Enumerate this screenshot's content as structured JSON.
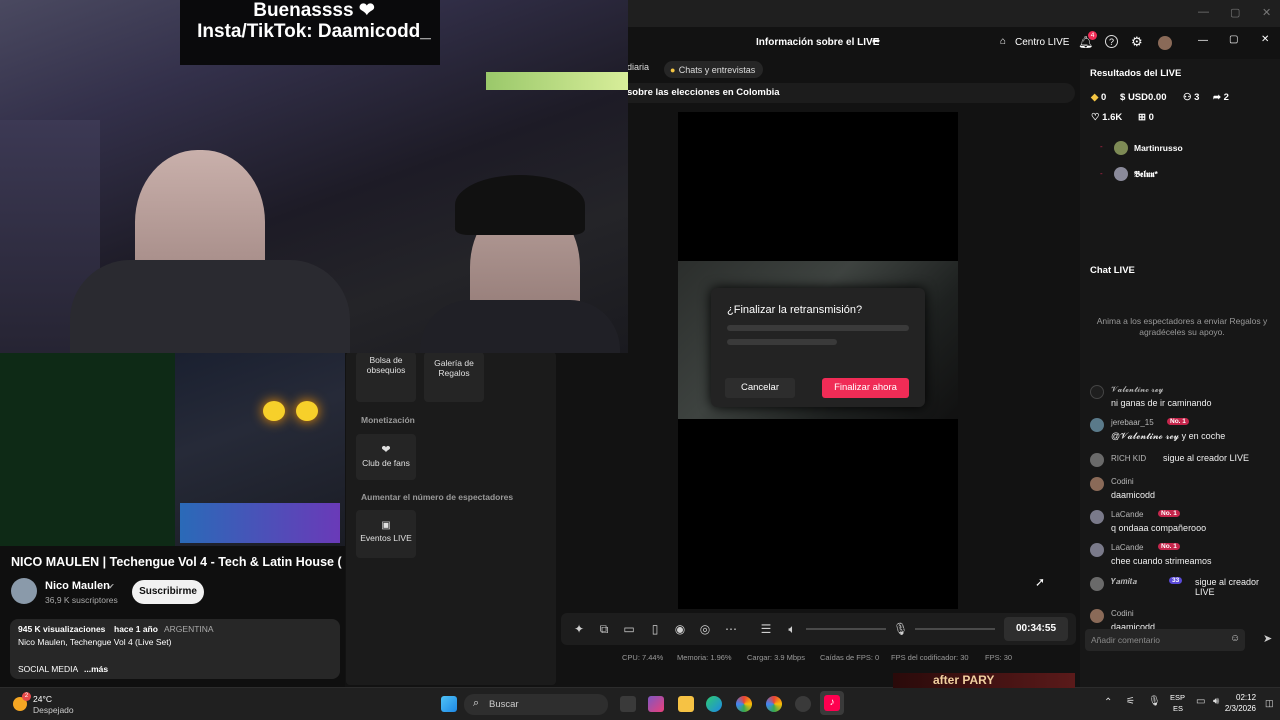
{
  "webcam": {
    "line1": "Buenassss ❤",
    "line2": "Insta/TikTok: Daamicodd_"
  },
  "studio": {
    "header": {
      "title": "Información sobre el LIVE",
      "center_label": "Centro LIVE",
      "notif_count": "4"
    },
    "tags": [
      "diaria",
      "Chats y entrevistas"
    ],
    "news": "sobre las elecciones en Colombia",
    "dialog": {
      "title": "¿Finalizar la retransmisión?",
      "cancel": "Cancelar",
      "confirm": "Finalizar ahora"
    },
    "left_panel": {
      "gift_bag": "Bolsa de obsequios",
      "gift_gallery": "Galería de Regalos",
      "monetization": "Monetización",
      "fan_club": "Club de fans",
      "boost": "Aumentar el número de espectadores",
      "live_events": "Eventos LIVE"
    },
    "timer": "00:34:55",
    "stats": {
      "cpu": "CPU: 7.44%",
      "mem": "Memoria: 1.96%",
      "load": "Cargar: 3.9 Mbps",
      "fps_drops": "Caídas de FPS: 0",
      "enc_fps": "FPS del codificador: 30",
      "fps": "FPS: 30"
    }
  },
  "results": {
    "title": "Resultados del LIVE",
    "coins": "0",
    "usd": "USD0.00",
    "viewers": "3",
    "shares": "2",
    "likes": "1.6K",
    "gifts": "0",
    "top_viewers": [
      "Martinrusso",
      "𝕭𝖊𝖑𝖚𝖚*"
    ]
  },
  "chat": {
    "title": "Chat LIVE",
    "hint": "Anima a los espectadores a enviar Regalos y agradéceles su apoyo.",
    "messages": [
      {
        "name": "𝓥𝓪𝓵𝓮𝓷𝓽𝓲𝓷𝓸 𝓻𝓮𝔂",
        "badge": "",
        "text": "ni ganas de ir caminando"
      },
      {
        "name": "jerebaar_15",
        "badge": "No. 1",
        "text": "@𝓥𝓪𝓵𝓮𝓷𝓽𝓲𝓷𝓸 𝓻𝓮𝔂 y en coche"
      },
      {
        "name": "RICH KID",
        "badge": "",
        "text": "sigue al creador LIVE"
      },
      {
        "name": "Codini",
        "badge": "",
        "text": "daamicodd"
      },
      {
        "name": "LaCande",
        "badge": "No. 1",
        "text": "q ondaaa compañerooo"
      },
      {
        "name": "LaCande",
        "badge": "No. 1",
        "text": "chee cuando strimeamos"
      },
      {
        "name": "𝒀𝒂𝒎𝒊𝒕𝒂",
        "badge": "33",
        "text": "sigue al creador LIVE"
      },
      {
        "name": "Codini",
        "badge": "",
        "text": "daamicodd_"
      }
    ],
    "placeholder": "Añadir comentario"
  },
  "youtube": {
    "title": "NICO MAULEN | Techengue Vol 4 - Tech & Latin House (",
    "channel": "Nico Maulen",
    "subs": "36,9 K suscriptores",
    "subscribe": "Suscribirme",
    "views": "945 K visualizaciones",
    "ago": "hace 1 año",
    "country": "ARGENTINA",
    "desc1": "Nico Maulen, Techengue Vol 4 (Live Set)",
    "desc2": "SOCIAL MEDIA",
    "more": "...más"
  },
  "taskbar": {
    "temp": "24°C",
    "weather": "Despejado",
    "weather_badge": "2",
    "search": "Buscar",
    "lang1": "ESP",
    "lang2": "ES",
    "time": "02:12",
    "date": "2/3/2026",
    "thumb_text": "after PARY"
  },
  "colors": {
    "accent": "#f02c56",
    "badge": "#c5264c"
  }
}
